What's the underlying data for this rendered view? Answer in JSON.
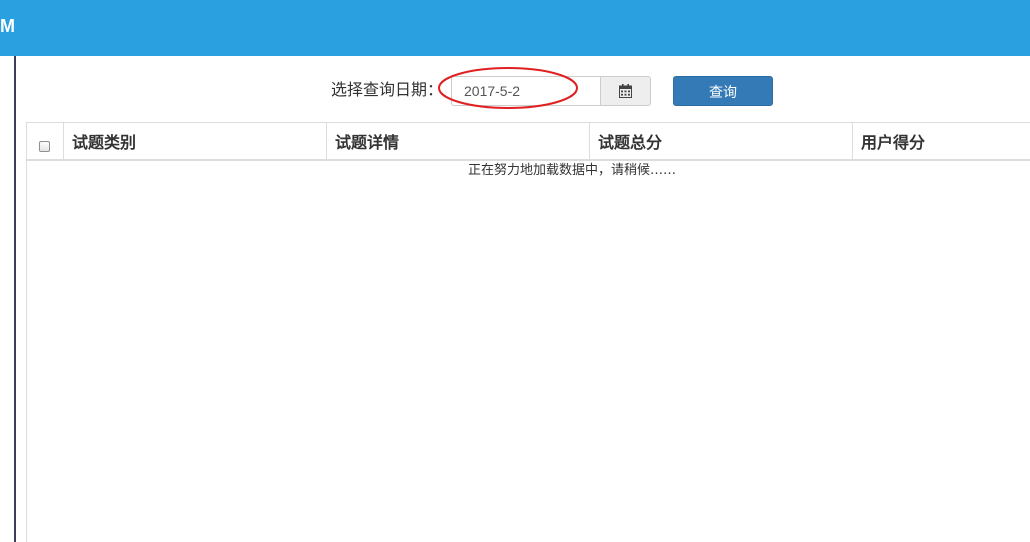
{
  "header": {
    "brand": "M"
  },
  "search": {
    "label": "选择查询日期：",
    "date_value": "2017-5-2",
    "calendar_icon": "calendar-icon",
    "query_label": "查询"
  },
  "table": {
    "columns": [
      "试题类别",
      "试题详情",
      "试题总分",
      "用户得分"
    ],
    "loading_text": "正在努力地加载数据中，请稍候……"
  },
  "colors": {
    "topbar": "#2ba0e0",
    "primary_button": "#337ab7",
    "annotation": "#e02020"
  }
}
